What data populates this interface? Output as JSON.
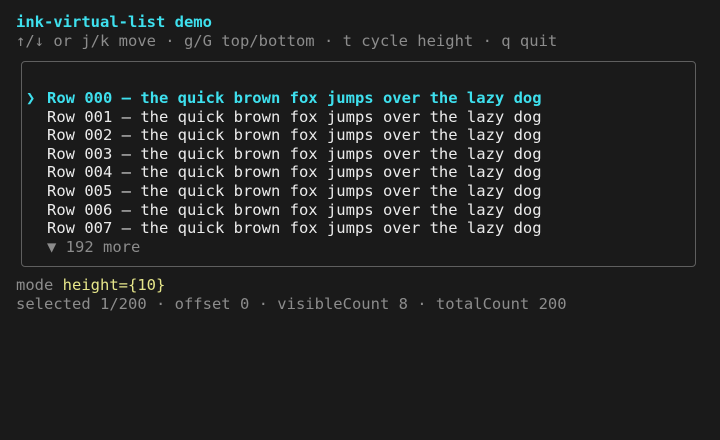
{
  "title": "ink-virtual-list demo",
  "help": "↑/↓ or j/k move · g/G top/bottom · t cycle height · q quit",
  "cursor_glyph": "❯",
  "rows": [
    {
      "label": "Row 000 — the quick brown fox jumps over the lazy dog",
      "selected": true
    },
    {
      "label": "Row 001 — the quick brown fox jumps over the lazy dog",
      "selected": false
    },
    {
      "label": "Row 002 — the quick brown fox jumps over the lazy dog",
      "selected": false
    },
    {
      "label": "Row 003 — the quick brown fox jumps over the lazy dog",
      "selected": false
    },
    {
      "label": "Row 004 — the quick brown fox jumps over the lazy dog",
      "selected": false
    },
    {
      "label": "Row 005 — the quick brown fox jumps over the lazy dog",
      "selected": false
    },
    {
      "label": "Row 006 — the quick brown fox jumps over the lazy dog",
      "selected": false
    },
    {
      "label": "Row 007 — the quick brown fox jumps over the lazy dog",
      "selected": false
    }
  ],
  "more": "▼ 192 more",
  "mode": {
    "label": "mode",
    "value": "height={10}"
  },
  "status": "selected 1/200 · offset 0 · visibleCount 8 · totalCount 200",
  "colors": {
    "accent": "#3ee0ee",
    "dim": "#8c8c8c",
    "value": "#e6e68a",
    "background": "#1a1a1a"
  }
}
